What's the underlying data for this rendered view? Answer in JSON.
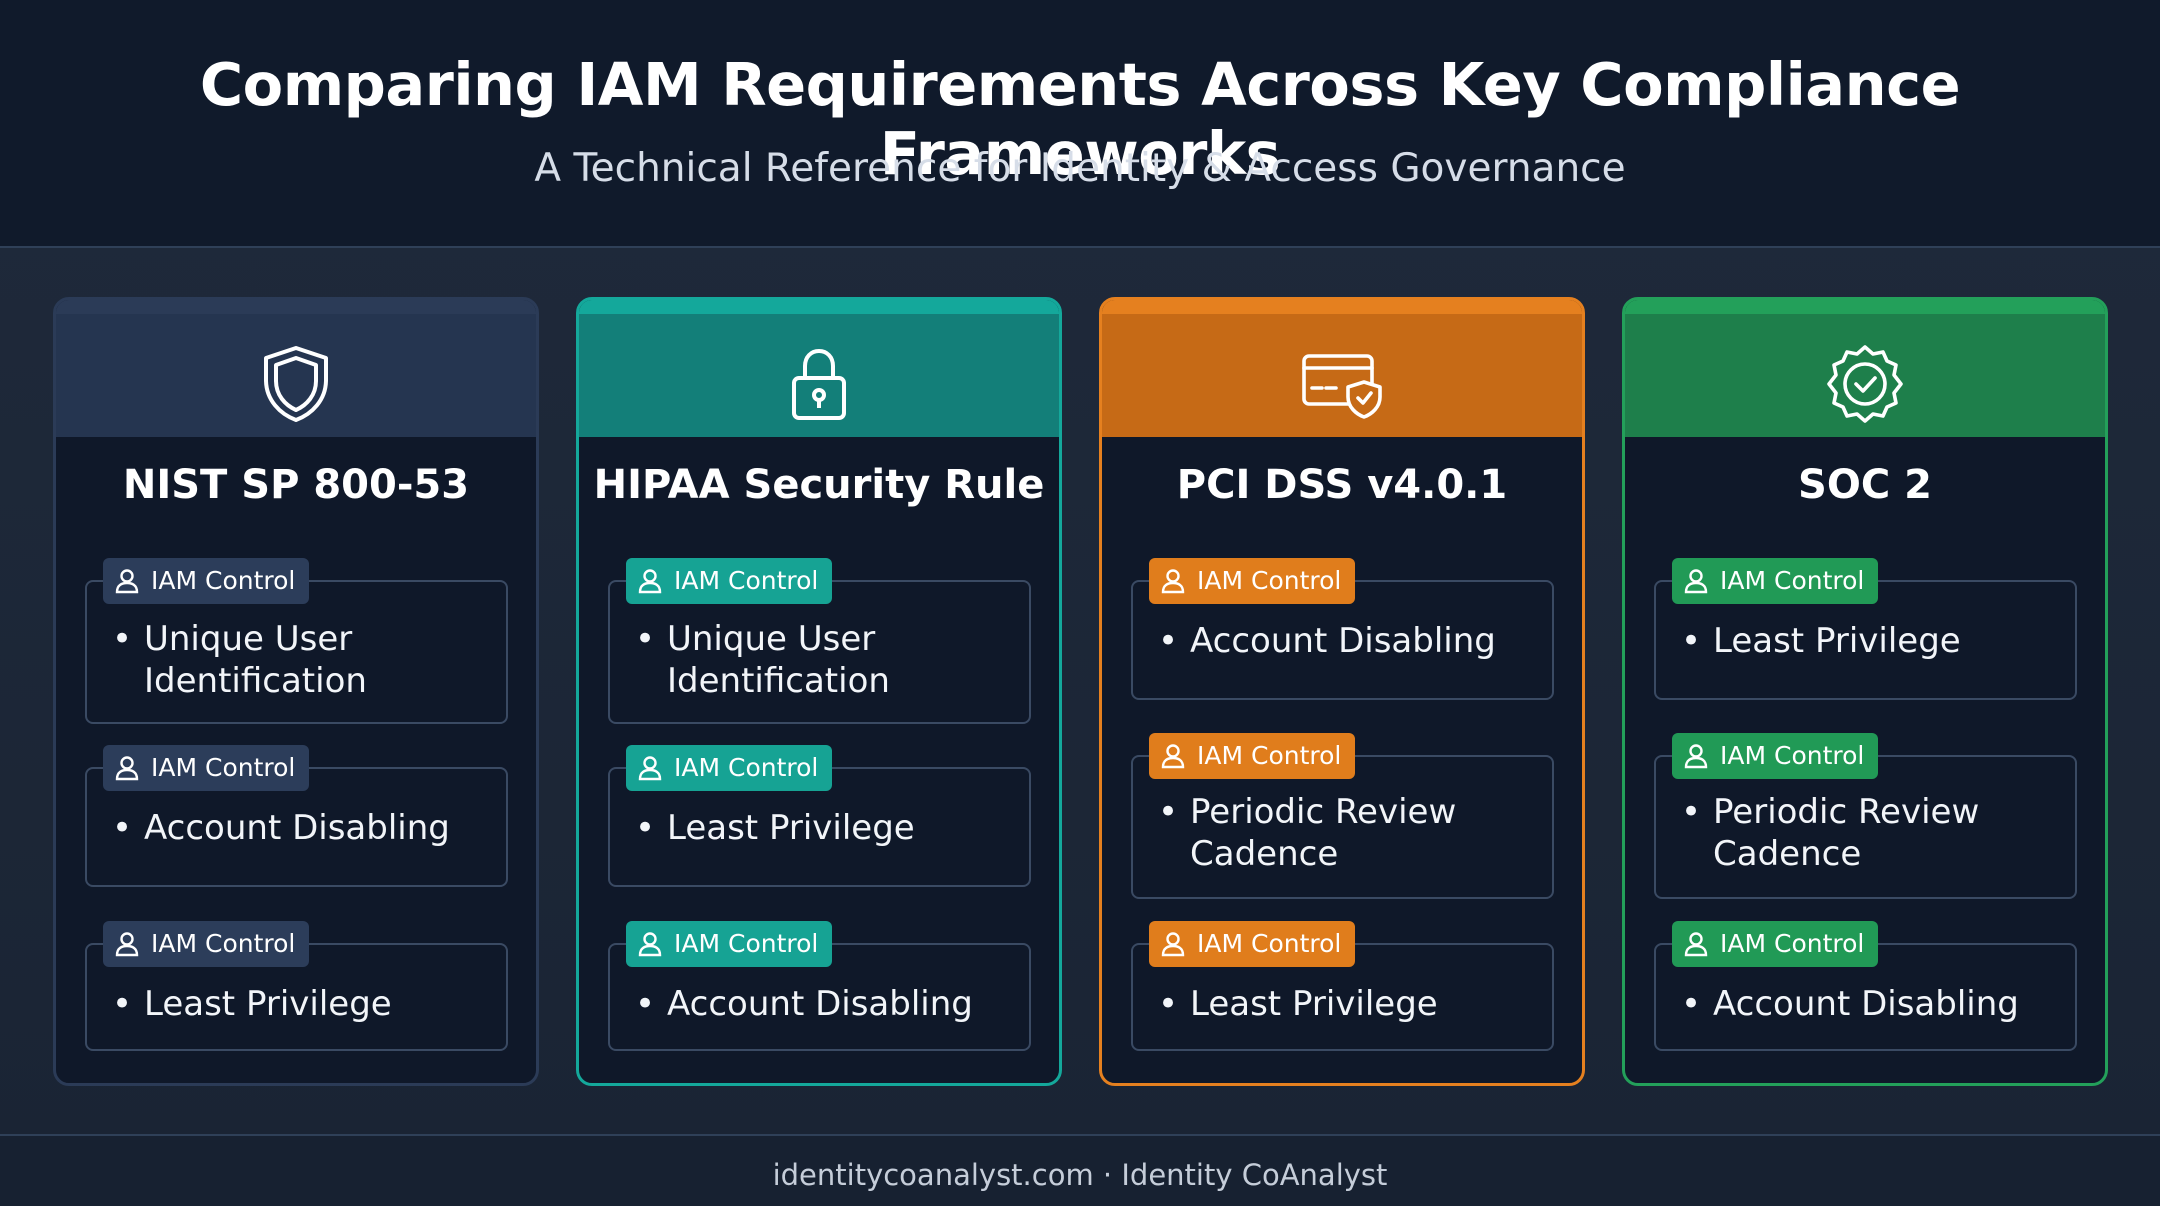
{
  "header": {
    "title": "Comparing IAM Requirements Across Key Compliance Frameworks",
    "subtitle": "A Technical Reference for Identity & Access Governance"
  },
  "badge_label": "IAM Control",
  "cards": [
    {
      "title": "NIST SP 800-53",
      "icon": "shield-icon",
      "accent": "#2b3b57",
      "items": [
        "Unique User Identification",
        "Account Disabling",
        "Least Privilege"
      ]
    },
    {
      "title": "HIPAA Security Rule",
      "icon": "lock-icon",
      "accent": "#14a89b",
      "items": [
        "Unique User Identification",
        "Least Privilege",
        "Account Disabling"
      ]
    },
    {
      "title": "PCI DSS v4.0.1",
      "icon": "credit-card-shield-icon",
      "accent": "#e5801f",
      "items": [
        "Account Disabling",
        "Periodic Review Cadence",
        "Least Privilege"
      ]
    },
    {
      "title": "SOC 2",
      "icon": "verified-badge-icon",
      "accent": "#23a05a",
      "items": [
        "Least Privilege",
        "Periodic Review Cadence",
        "Account Disabling"
      ]
    }
  ],
  "footer": {
    "text": "identitycoanalyst.com · Identity CoAnalyst"
  }
}
